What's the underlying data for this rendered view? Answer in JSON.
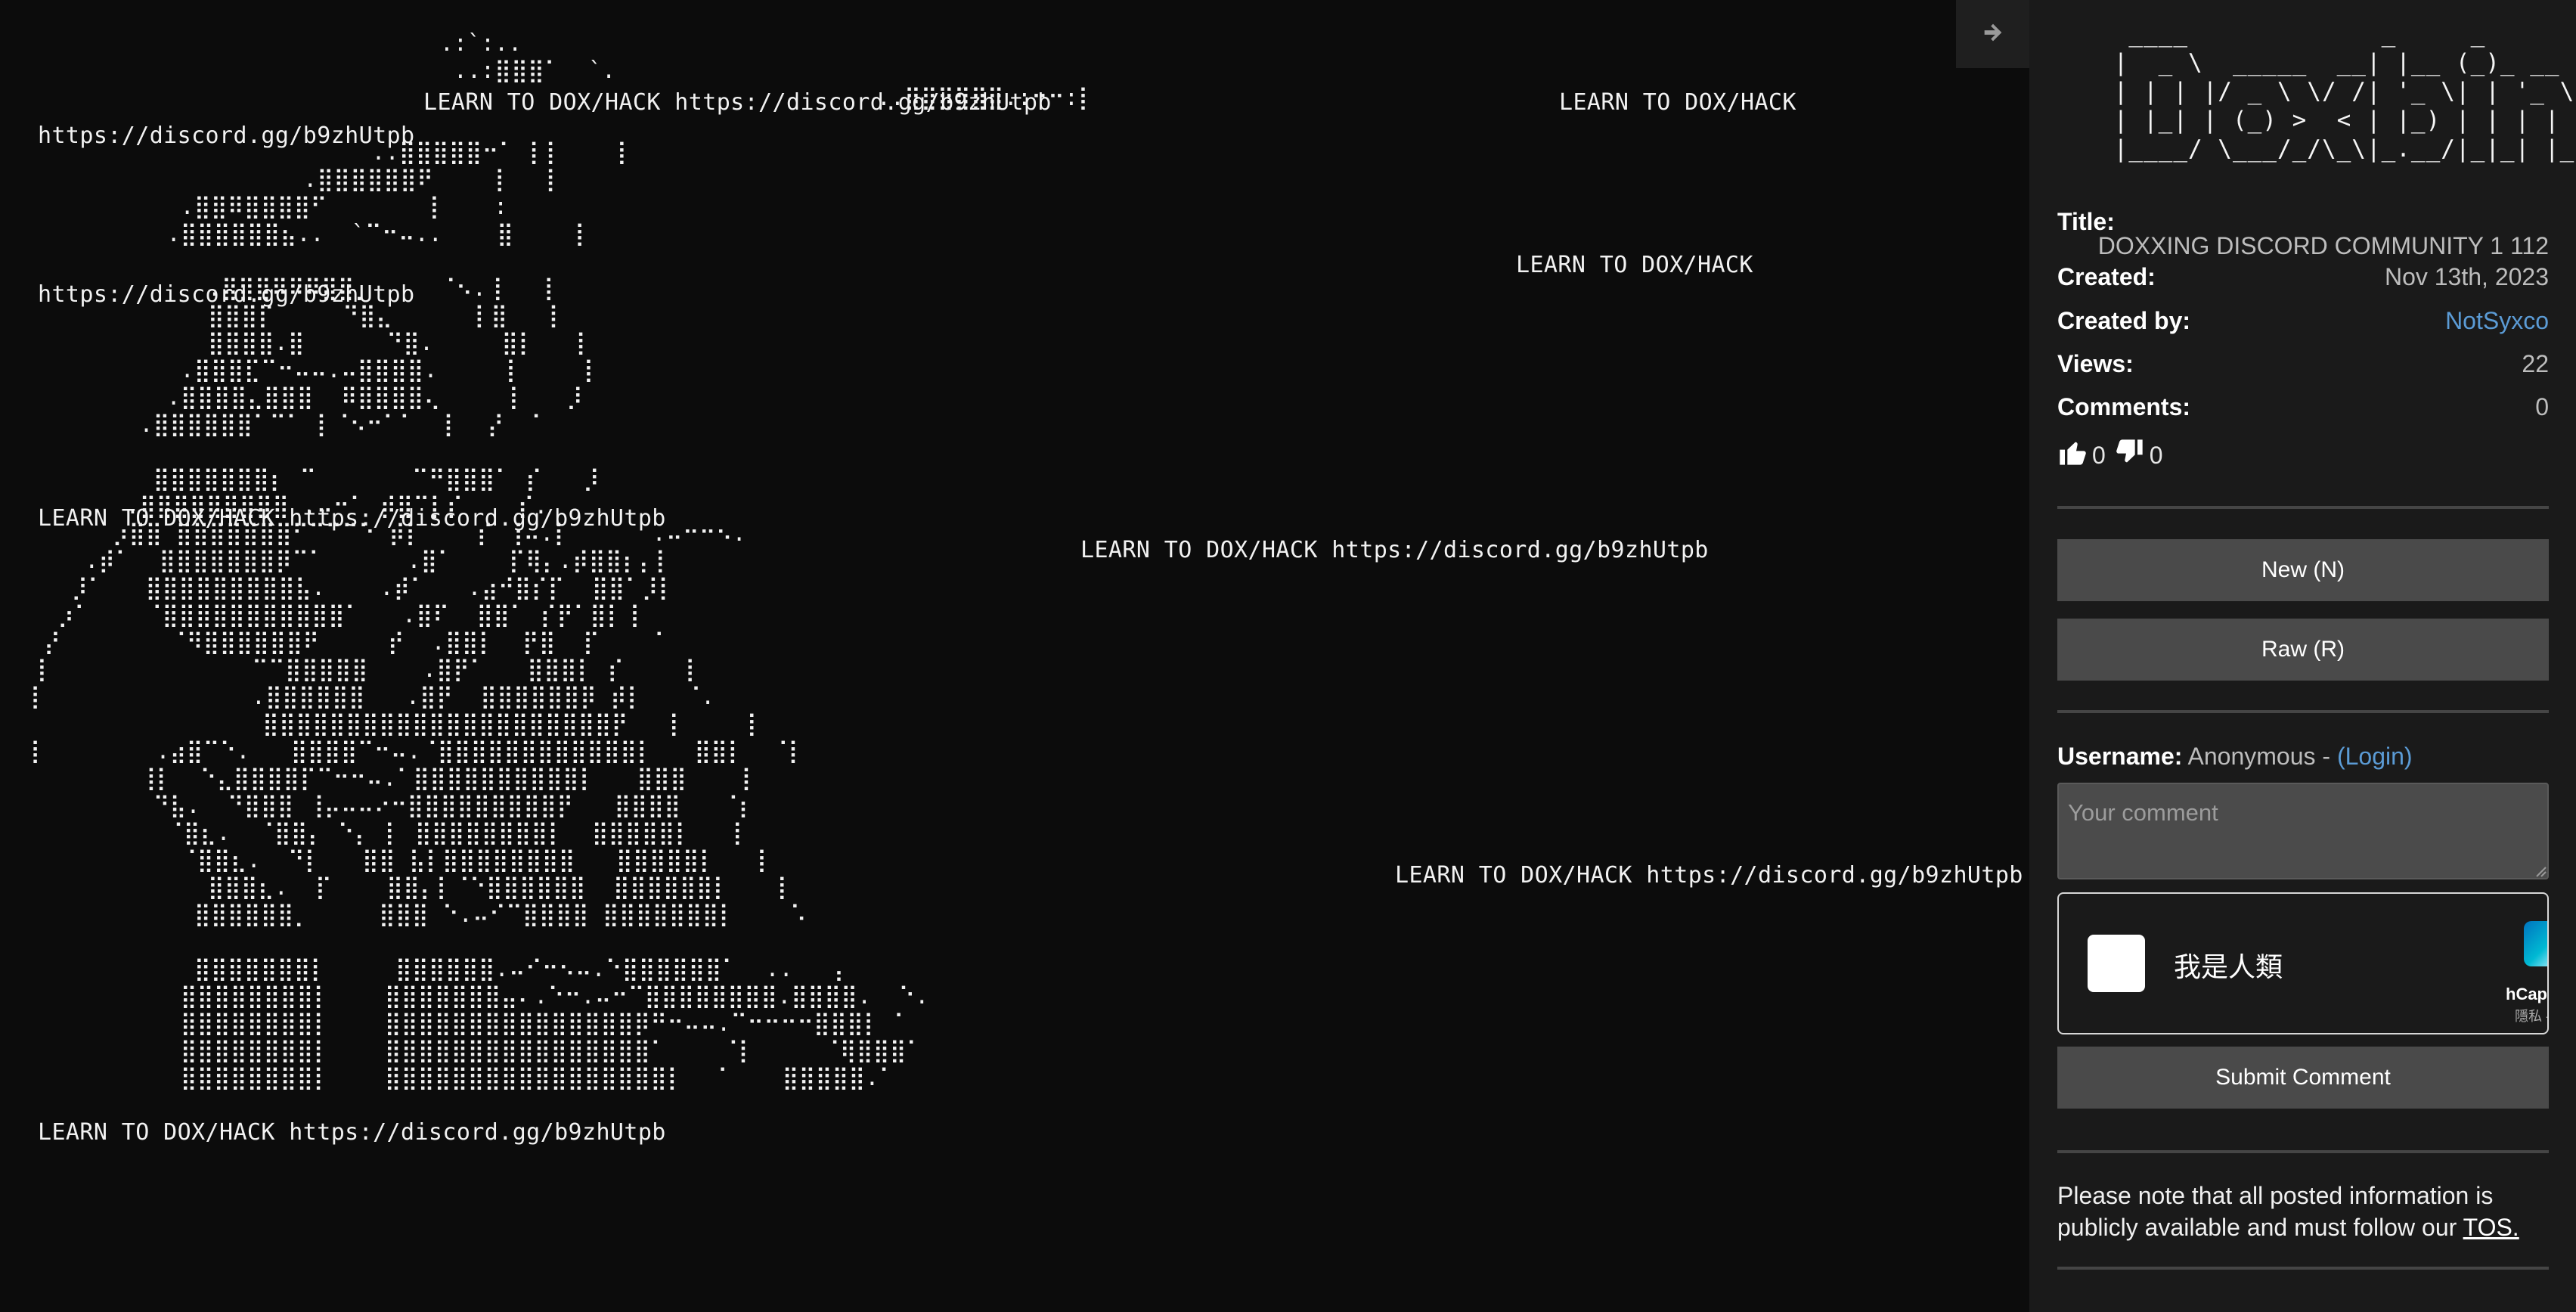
{
  "paste": {
    "spam_lines": [
      {
        "text": "LEARN TO DOX/HACK https://discord.gg/b9zhUtpb"
      },
      {
        "text": "LEARN TO DOX/HACK"
      },
      {
        "text": "https://discord.gg/b9zhUtpb"
      },
      {
        "text": "LEARN TO DOX/HACK"
      },
      {
        "text": "https://discord.gg/b9zhUtpb"
      },
      {
        "text": "LEARN TO DOX/HACK https://discord.gg/b9zhUtpb"
      },
      {
        "text": "LEARN TO DOX/HACK https://discord.gg/b9zhUtpb"
      },
      {
        "text": "LEARN TO DOX/HACK https://discord.gg/b9zhUtpb"
      },
      {
        "text": "LEARN TO DOX/HACK https://discord.gg/b9zhUtpb"
      }
    ],
    "ascii_art": "                              .:`:..\n                               ..:⣿⣿⣿⠁  `.\n                                                              ..⣿⣿⣿⣿⣿⣿.:⠒⠒:⡇\n\n                         ..⣿⣿⣿⣿⣿⠒⠁ ⡇⡇    ⡇\n                    .⣿⣿⣿⣿⣿⣿⠟    ⢸   ⡇\n           .⣿⣿⠿⣿⣿⣿⣿⠋       ⢸    :\n          .⣿⣿⣿⣿⣿⣿⣦..  `⠉⠒⠤..    ⣿    ⢸\n\n             .⣿⣿⣿⠿⠿⠿⣿⣿⡀     ⠈⠢.⢸   ⡇\n             ⣿⣿⣿⡏     ⠙⣿⣄      ⡇⣿   ⡇\n             ⣿⣿⣿⣿.⣿      ⠙⣿.     ⣿⡇   ⡇\n           .⣿⣿⣿⣏⠉⠒⠤⠤.⠤⣿⣿⣿⣿.     ⡇    ⢸\n          .⣿⣿⣿⣿⣄⣿⣿⣿  ⠿⣿⣿⣿⣿⢄     ⡇   ⡸\n        .⣿⣿⣿⣿⣿⣿⠁⠉⠁ ⡇⠈⠢⠒⠁⠁  ⡇  ⡜  ⠁\n\n         ⣿⣿⣿⣿⣿⣿⣿⡆ ⠉       ⠉⠛⣿⣿⣿⠁ ⡎   ⡸\n       .⣿⣿⣿⣿⣿⣿⣿⣿⣿ .⠤⠒⠁ ⡾⣿⠉⡇⡎    ⡎.\n      ⡰⣿⣿ ⣿⣿⣿⣿⣿⣿⣿⠋⠉⠉⠉⠑ ⡾⡇    ⡎ ⢸⠤.⡇      .⠤⠒⠒⠢.\n    .⡾⠁  ⣿⣿⣿⣿⣿⣿⣿⡿⠉⠁      .⣿⠁    ⡏⢿⡄.⡾⣿⣿⡆⡄⡇\n   ⡸⠁   ⣿⣿⣿⣿⣿⣿⣿⣿⣿⣧.    .⡾⠁   .⣴⠚⣿⡎⡏  ⣿⣿⠁⡸⡇\n  ⡰⠁    ⠈⣿⣿⣿⣿⣿⣿⣿⣿⣿⣿⣿⠁   .⣿⠏  ⣿⣿⠁ ⡎⡟⠁⣿⡇⢸\n ⡜        ⠈⠻⣿⣿⣿⣿⣿⣿⠟     ⡞  .⣿⣿⡇  ⡟⣿  ⡏    ⠁\n⢸               ⠉⠉⣿⣿⣿⣿⣿    .⣿⡟⠁   ⣿⣿⣿⡇ ⡎    ⢸\n⡇               .⣿⣿⣿⣿⣿⣿   .⣿⡟  ⣿⣿⣿⣿⣿⣿⡿ ⡾⡇   ⠈.\n                 ⣿⣿⣿⣿⣿⣿⣿⣿⣿⣿⣿⣿⣿⣿⣿⣿⣿⣿⣿⣿⣿⡟   ⡇    ⢸\n⡇        .⣴⣿⠉⠑.   ⣿⣿⣿⣿⠉⠒⠤.⠈⣿⣿⣿⣿⣿⣿⣿⣿⣿⣿⣿⣿⡇   ⣿⣿⡇  ⠈⡇\n        ⢸⡇  ⠑⣄⣿⣿⣿⣿⡏⠉⠒⠒⠤.⠁⣿⣿⣿⣿⣿⣿⣿⣿⣿⣿⡇   ⣿⣿⣿    ⡇\n         ⠙⣧.  ⠙⣿⣿⣿ ⢸⡤⠤⠤⠔⠒⣿⣿⣿⣿⣿⣿⣿⣿⣿⡟   ⣿⣿⣿⣿   ⠈⡆\n          ⠈⣿⣆.  ⠈⣿⣿⡄ ⠑⡄ ⡇ ⣿⣿⣿⣿⣿⣿⣿⣿⡇  ⣿⣿⣿⣿⣿⡇   ⡇\n           ⠈⣿⣿⣆.  ⠙⡇   ⣿⣿ ⣧⡇⣿⣿⣿⣿⣿⣿⣿⣿   ⣿⣿⣿⣿⣿⡇   ⡇\n             ⣿⣿⣿⣆.  ⡏    ⣿⣿⡄⡇⠈⠑⣿⣿⣿⣿⣿⣿  ⣿⣿⣿⣿⣿⣿⡇   ⢸\n            ⣿⣿⣿⣿⣿⣿⡀     ⣿⣿⣿ ⠑.⠤⠊⠉⣿⣿⣿⣿ ⣿⣿⣿⣿⣿⣿⣿⡇    ⠡\n\n            ⣿⣿⣿⣿⣿⣿⣿⡇     ⣿⣿⣿⣿⣿⣿.⠤⠊⠒⠢⠤.⠑⣿⣿⣿⣿⣿⣿⠁  ..   ⡄\n           ⣿⣿⣿⣿⣿⣿⣿⣿⡇    ⣿⣿⣿⣿⣿⣿⣿⣤⠄.⠑⠒.⠤⠒⠉⣿⣿⣿⣿⣿⣿⣿⣿.⣿⣿⣿⣿.  ⠑.\n           ⣿⣿⣿⣿⣿⣿⣿⣿⡇    ⣿⣿⣿⣿⣿⣿⣿⣿⣿⣿⣿⣿⣿⣿⣿⡿⠛⠒⠤⠤.⠉⠒⠒⠒⠒⣿⣿⣿⡇ ⠁\n           ⣿⣿⣿⣿⣿⣿⣿⣿⡇    ⣿⣿⣿⣿⣿⣿⣿⣿⣿⣿⣿⣿⣿⣿⣿⣿⠁    ⠈⡇     ⠈⢿⣿⣿⣿⠁\n           ⣿⣿⣿⣿⣿⣿⣿⣿⡇    ⣿⣿⣿⣿⣿⣿⣿⣿⣿⣿⣿⣿⣿⣿⣿⣿⣿⡇  ⠈    ⣿⣿⣿⣿⣿.⠁"
  },
  "sidebar": {
    "logo_ascii": "  ____             _     _\n |  _ \\  _____  __| |__ (_)_ __\n | | | |/ _ \\ \\/ /| '_ \\| | '_ \\\n | |_| | (_) >  < | |_) | | | | |\n |____/ \\___/_/\\_\\|_.__/|_|_| |_|",
    "title_label": "Title:",
    "title_value": "DOXXING DISCORD COMMUNITY 1 112",
    "created_label": "Created:",
    "created_value": "Nov 13th, 2023",
    "created_by_label": "Created by:",
    "created_by_value": "NotSyxco",
    "views_label": "Views:",
    "views_value": "22",
    "comments_label": "Comments:",
    "comments_value": "0",
    "upvotes": "0",
    "downvotes": "0",
    "new_button": "New (N)",
    "raw_button": "Raw (R)",
    "username_label": "Username:",
    "username_value": "Anonymous -",
    "login_link": "(Login)",
    "comment_placeholder": "Your comment",
    "captcha_label": "我是人類",
    "captcha_brand": "hCaptcha",
    "captcha_sub": "隱私 - 條款",
    "submit_button": "Submit Comment",
    "notice_text": "Please note that all posted information is publicly available and must follow our ",
    "tos_link": "TOS."
  },
  "colors": {
    "background": "#0d0d0d",
    "sidebar": "#1a1a1a",
    "button": "#4a4a4a",
    "link": "#5b9bd5",
    "text": "#e6e6e6"
  },
  "icons": [
    "chevron-right-icon",
    "thumbs-up-icon",
    "thumbs-down-icon",
    "hcaptcha-logo-icon",
    "resize-grip-icon"
  ]
}
